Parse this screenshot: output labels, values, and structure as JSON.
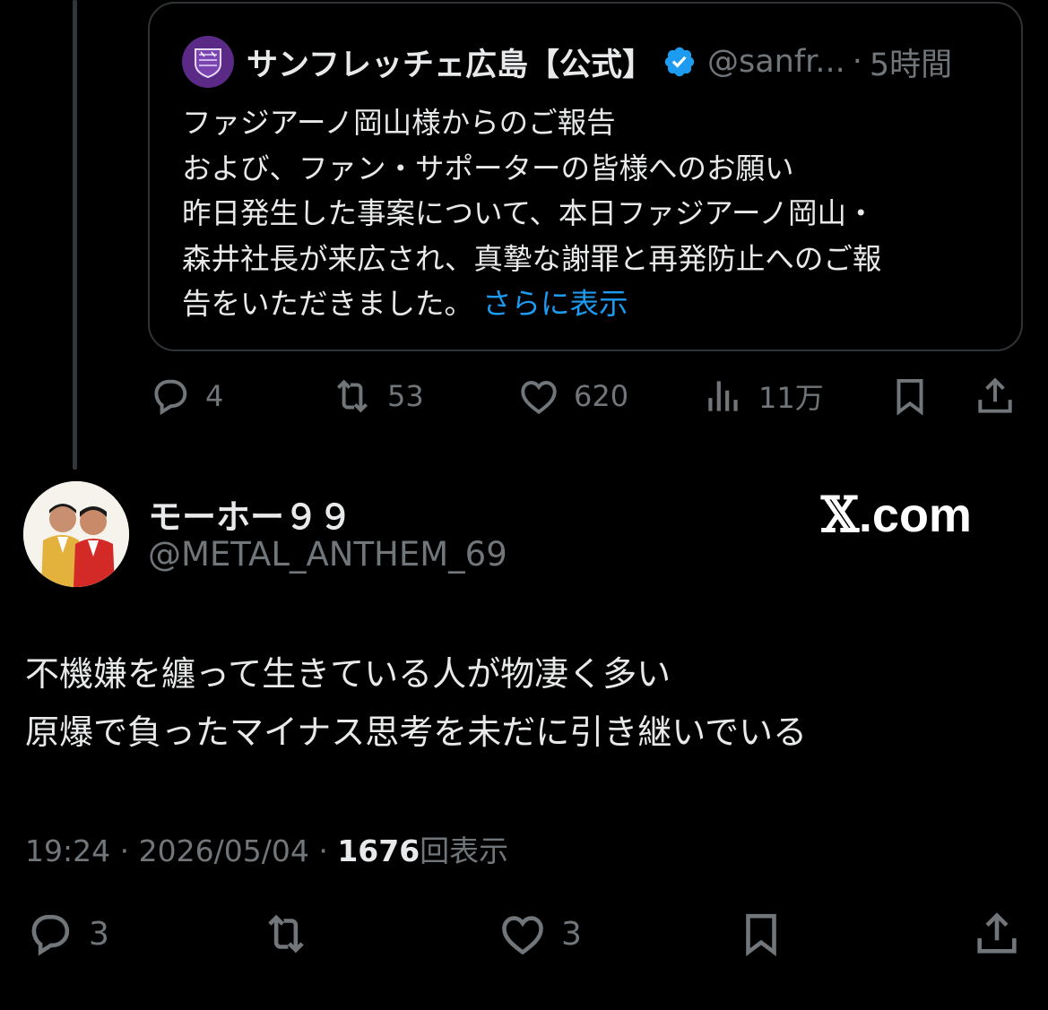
{
  "quoted_tweet": {
    "name": "サンフレッチェ広島【公式】",
    "handle": "@sanfr...",
    "separator": "·",
    "time": "5時間",
    "text": "ファジアーノ岡山様からのご報告\nおよび、ファン・サポーターの皆様へのお願い\n昨日発生した事案について、本日ファジアーノ岡山・\n森井社長が来広され、真摯な謝罪と再発防止へのご報\n告をいただきました。",
    "show_more": "さらに表示",
    "actions": {
      "replies": "4",
      "reposts": "53",
      "likes": "620",
      "views": "11万"
    }
  },
  "post": {
    "display_name": "モーホー９９",
    "handle": "@METAL_ANTHEM_69",
    "watermark_x": "𝕏",
    "watermark_domain": ".com",
    "text": "不機嫌を纏って生きている人が物凄く多い\n原爆で負ったマイナス思考を未だに引き継いでいる",
    "time": "19:24",
    "sep1": "·",
    "date": "2026/05/04",
    "sep2": "·",
    "views_count": "1676",
    "views_label": "回表示",
    "actions": {
      "replies": "3",
      "likes": "3"
    }
  },
  "colors": {
    "background": "#000000",
    "text": "#e7e9ea",
    "muted": "#71767b",
    "link": "#1d9bf0",
    "border": "#2f3336"
  },
  "icons": [
    "reply-icon",
    "repost-icon",
    "like-icon",
    "views-icon",
    "bookmark-icon",
    "share-icon",
    "verified-icon"
  ]
}
